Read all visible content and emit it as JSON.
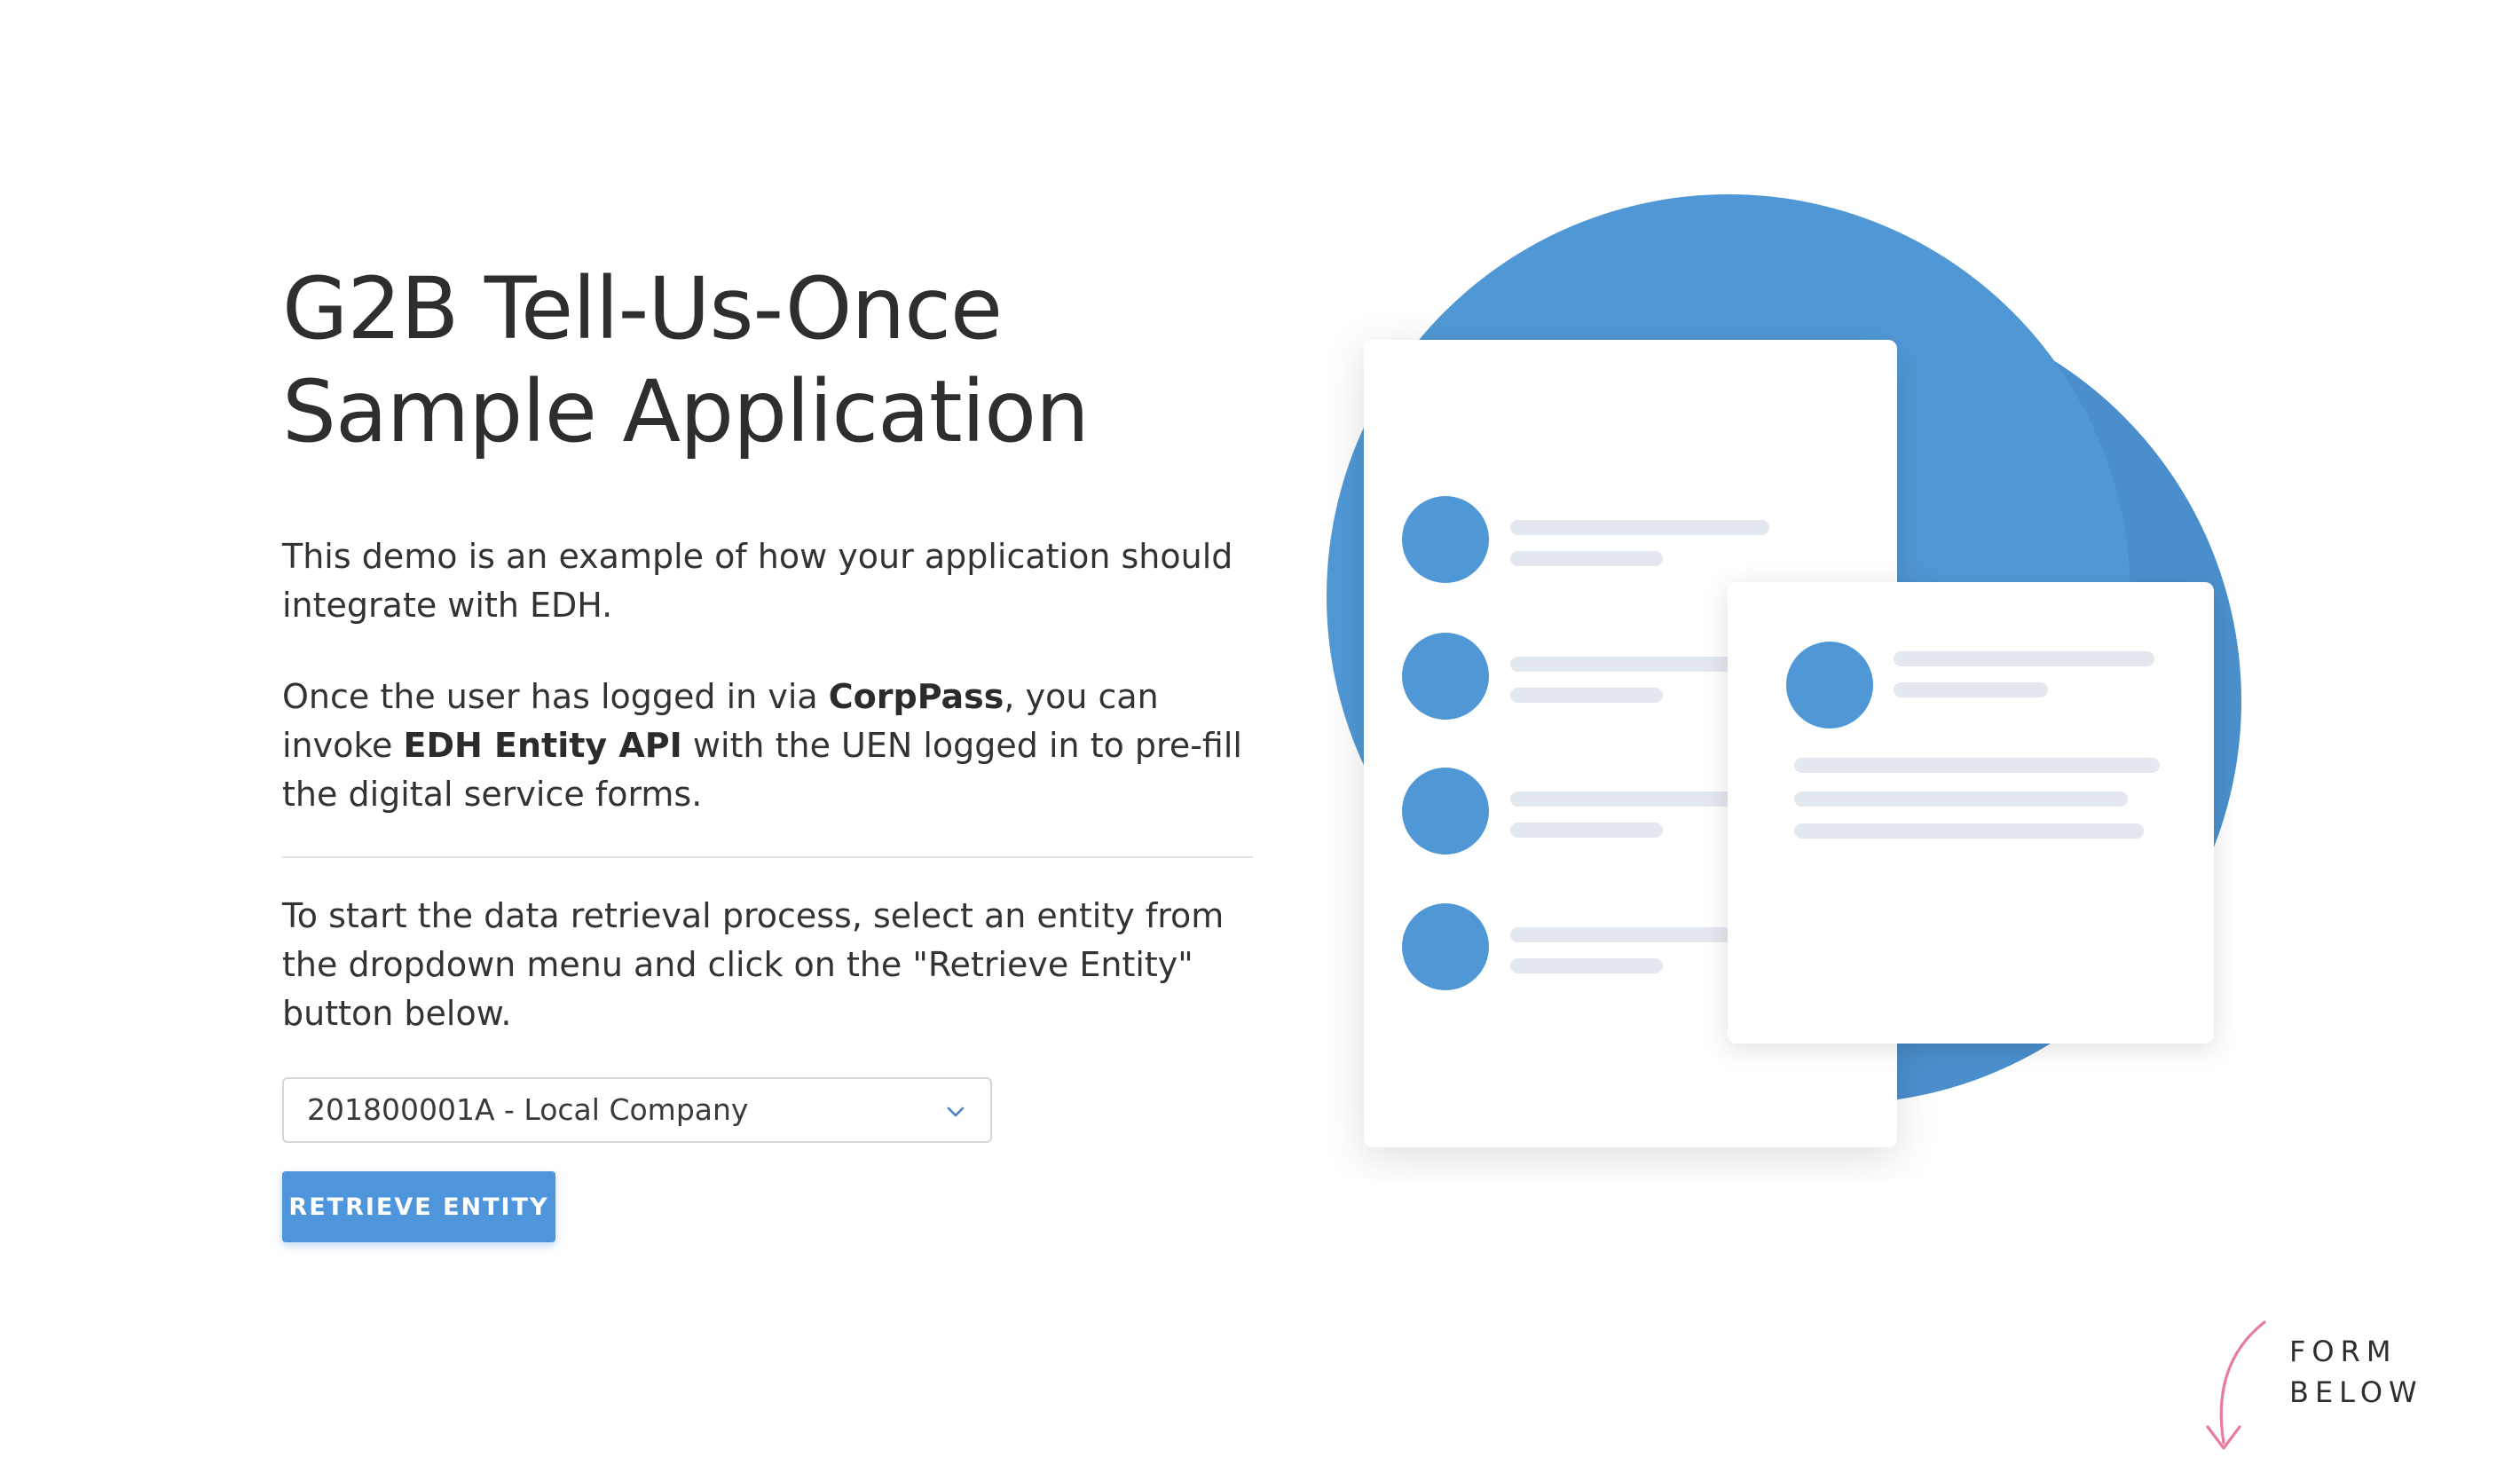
{
  "hero": {
    "title_line1": "G2B Tell-Us-Once",
    "title_line2": "Sample Application",
    "intro": "This demo is an example of how your application should integrate with EDH.",
    "p2_part1": "Once the user has logged in via ",
    "p2_bold1": "CorpPass",
    "p2_part2": ", you can invoke ",
    "p2_bold2": "EDH Entity API",
    "p2_part3": " with the UEN logged in to pre-fill the digital service forms.",
    "instructions": "To start the data retrieval process, select an entity from the dropdown menu and click on the \"Retrieve Entity\" button below."
  },
  "entity_select": {
    "selected": "201800001A - Local Company",
    "icon": "chevron-down-icon"
  },
  "retrieve_button": {
    "label": "RETRIEVE ENTITY"
  },
  "scroll_hint": {
    "line1": "FORM",
    "line2": "BELOW",
    "icon": "curved-arrow-down-icon"
  },
  "colors": {
    "accent": "#4e95dc",
    "circle": "#5098d5",
    "skeleton": "#e3e7ee",
    "arrow": "#e97aa3",
    "text": "#333333"
  }
}
